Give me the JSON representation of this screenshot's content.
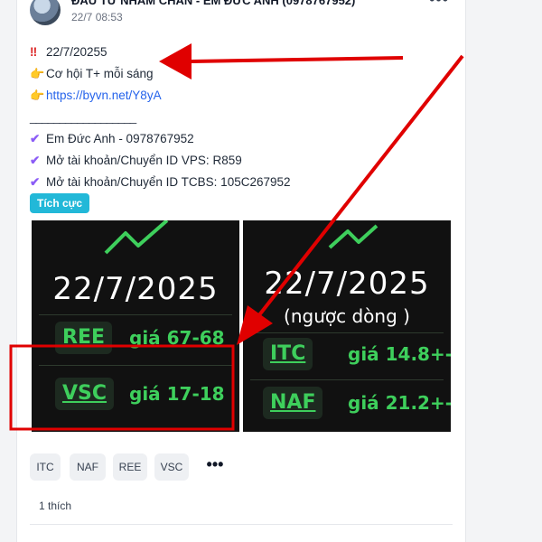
{
  "post": {
    "author": "ĐẦU TƯ NHÀM CHÁN - EM ĐỨC ANH (0978767952)",
    "time": "22/7 08:53",
    "more": "•••",
    "lines": {
      "date_line": "22/7/20255",
      "opportunity": "Cơ hội T+ mỗi sáng",
      "link": "https://byvn.net/Y8yA",
      "separator": "__________________",
      "contact": "Em Đức Anh - 0978767952",
      "vps": "Mở tài khoản/Chuyển ID VPS: R859",
      "tcbs": "Mở tài khoản/Chuyển ID TCBS: 105C267952"
    },
    "sentiment_tag": "Tích cực"
  },
  "images": {
    "left": {
      "date": "22/7/2025",
      "rows": [
        {
          "ticker": "REE",
          "price": "giá 67-68"
        },
        {
          "ticker": "VSC",
          "price": "giá  17-18"
        }
      ]
    },
    "right": {
      "date": "22/7/2025",
      "subtitle": "(ngược dòng )",
      "rows": [
        {
          "ticker": "ITC",
          "price": "giá 14.8+-"
        },
        {
          "ticker": "NAF",
          "price": "giá 21.2+-"
        }
      ]
    }
  },
  "chips": [
    "ITC",
    "NAF",
    "REE",
    "VSC"
  ],
  "chip_more": "•••",
  "likes": "1 thích",
  "colors": {
    "accent_tag": "#22b8d8",
    "ticker_green": "#3ecf5c",
    "annotation_red": "#e00000",
    "link_blue": "#2563eb"
  },
  "icons": {
    "exclamation": "double-exclamation-icon",
    "hand": "pointing-hand-icon",
    "check": "check-mark-icon",
    "chart": "trend-up-chart-icon"
  }
}
